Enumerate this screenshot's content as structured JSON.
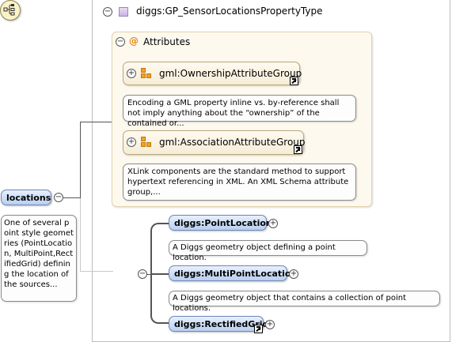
{
  "type": {
    "title": "diggs:GP_SensorLocationsPropertyType",
    "toggle": "−"
  },
  "attributes": {
    "label": "Attributes",
    "at_symbol": "@",
    "toggle": "−",
    "groups": [
      {
        "label": "gml:OwnershipAttributeGroup",
        "toggle": "+",
        "doc": "Encoding a GML property inline vs. by-reference shall not imply anything about the “ownership” of the contained or..."
      },
      {
        "label": "gml:AssociationAttributeGroup",
        "toggle": "+",
        "doc": "XLink components are the standard method to support hypertext referencing in XML. An XML Schema attribute group,..."
      }
    ]
  },
  "root_element": {
    "label": "locations",
    "toggle": "−",
    "doc": "One of several point style geometries (PointLocation, MultiPoint,RectifiedGrid) defining the location of the sources..."
  },
  "choice": {
    "icon": "choice-compositor-icon",
    "toggle": "−"
  },
  "elements": [
    {
      "label": "diggs:PointLocation",
      "toggle": "+",
      "doc": "A Diggs geometry object defining a point location."
    },
    {
      "label": "diggs:MultiPointLocation",
      "toggle": "+",
      "doc": "A Diggs geometry object that contains a collection of point locations."
    },
    {
      "label": "diggs:RectifiedGrid",
      "toggle": "+",
      "doc": ""
    }
  ],
  "colors": {
    "element_fill": "#b9cff0",
    "attribute_fill": "#fdf9ef",
    "group_icon": "#f2a124",
    "type_icon": "#c9b2e6"
  }
}
